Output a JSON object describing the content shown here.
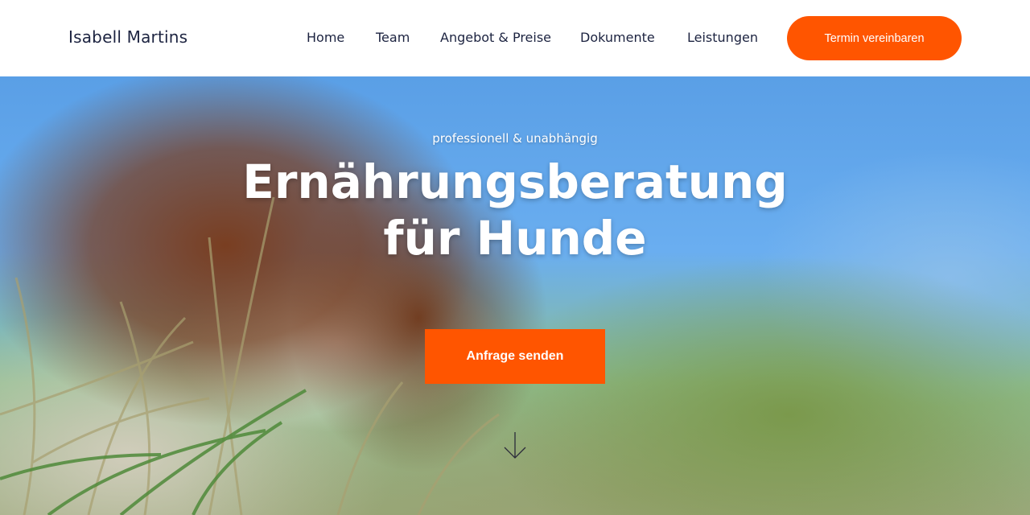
{
  "header": {
    "brand": "Isabell Martins",
    "nav": [
      {
        "label": "Home"
      },
      {
        "label": "Team"
      },
      {
        "label": "Angebot & Preise"
      },
      {
        "label": "Dokumente"
      },
      {
        "label": "Leistungen"
      }
    ],
    "cta_label": "Termin vereinbaren"
  },
  "hero": {
    "tagline": "professionell & unabhängig",
    "title_line1": "Ernährungsberatung",
    "title_line2": "für Hunde",
    "cta_label": "Anfrage senden",
    "scroll_icon": "arrow-down-icon"
  },
  "colors": {
    "accent": "#ff5500",
    "text_dark": "#1c2340",
    "hero_text": "#ffffff"
  }
}
